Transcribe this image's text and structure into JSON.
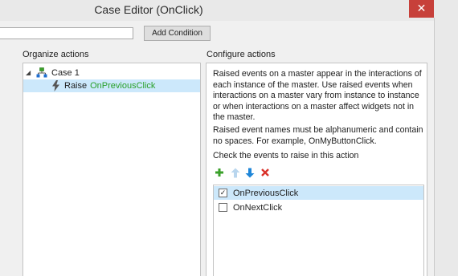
{
  "window": {
    "title": "Case Editor (OnClick)",
    "close_glyph": "✕"
  },
  "top_bar": {
    "condition_value": "",
    "add_condition_label": "Add Condition"
  },
  "organize": {
    "label": "Organize actions",
    "tree": {
      "expand_glyph": "◢",
      "case_label": "Case 1",
      "case_icon": "case-tree-icon",
      "action_verb": "Raise",
      "action_event": "OnPreviousClick",
      "action_icon": "lightning-bolt-icon"
    }
  },
  "configure": {
    "label": "Configure actions",
    "description_1": "Raised events on a master appear in the interactions of each instance of the master. Use raised events when interactions on a master vary from instance to instance or when interactions on a master affect widgets not in the master.",
    "description_2": "Raised event names must be alphanumeric and contain no spaces. For example, OnMyButtonClick.",
    "check_prompt": "Check the events to raise in this action",
    "toolbar_icons": [
      "add-icon",
      "move-up-icon",
      "move-down-icon",
      "delete-icon"
    ],
    "events": [
      {
        "label": "OnPreviousClick",
        "checked": true,
        "selected": true
      },
      {
        "label": "OnNextClick",
        "checked": false,
        "selected": false
      }
    ]
  },
  "colors": {
    "close_button": "#c7403a",
    "selection": "#cce8fb",
    "event_name": "#2aa02a",
    "add_icon": "#3aa02a",
    "move_up_icon": "#b9d6ee",
    "move_down_icon": "#1f86d8",
    "delete_icon": "#d9332b"
  }
}
